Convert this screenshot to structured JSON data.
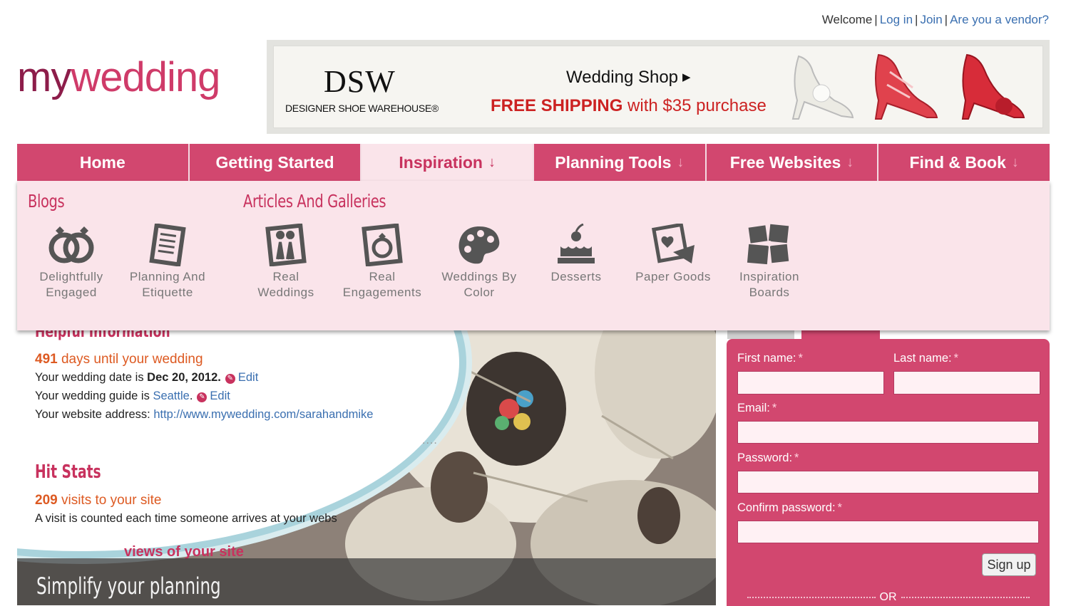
{
  "header": {
    "welcome": "Welcome",
    "login": "Log in",
    "join": "Join",
    "vendor": "Are you a vendor?"
  },
  "logo": {
    "my": "my",
    "wedding": "wedding"
  },
  "banner": {
    "brand": "DSW",
    "brand_sub": "DESIGNER SHOE WAREHOUSE®",
    "shop": "Wedding Shop",
    "free_bold": "FREE SHIPPING",
    "free_rest": " with $35 purchase"
  },
  "nav": {
    "tabs": [
      {
        "label": "Home",
        "arrow": ""
      },
      {
        "label": "Getting Started",
        "arrow": ""
      },
      {
        "label": "Inspiration",
        "arrow": "↓"
      },
      {
        "label": "Planning Tools",
        "arrow": "↓"
      },
      {
        "label": "Free Websites",
        "arrow": "↓"
      },
      {
        "label": "Find & Book",
        "arrow": "↓"
      }
    ]
  },
  "dropdown": {
    "blogs_title": "Blogs",
    "articles_title": "Articles And Galleries",
    "items": [
      {
        "line1": "Delightfully",
        "line2": "Engaged",
        "icon": "rings-icon"
      },
      {
        "line1": "Planning And",
        "line2": "Etiquette",
        "icon": "checklist-icon"
      },
      {
        "line1": "Real",
        "line2": "Weddings",
        "icon": "couple-photo-icon"
      },
      {
        "line1": "Real",
        "line2": "Engagements",
        "icon": "ring-photo-icon"
      },
      {
        "line1": "Weddings By",
        "line2": "Color",
        "icon": "palette-icon"
      },
      {
        "line1": "Desserts",
        "line2": "",
        "icon": "cake-icon"
      },
      {
        "line1": "Paper Goods",
        "line2": "",
        "icon": "envelope-icon"
      },
      {
        "line1": "Inspiration",
        "line2": "Boards",
        "icon": "boards-icon"
      }
    ]
  },
  "info": {
    "heading": "Helpful Information",
    "days_count": "491",
    "days_text": " days until your wedding",
    "date_prefix": "Your wedding date is ",
    "date_value": "Dec 20, 2012.",
    "edit": "Edit",
    "guide_prefix": "Your wedding guide is ",
    "guide_value": "Seattle",
    "guide_suffix": ".",
    "site_prefix": "Your website address: ",
    "site_url": "http://www.mywedding.com/sarahandmike",
    "hit_title": "Hit Stats",
    "visits_count": "209",
    "visits_text": " visits to your site",
    "visit_desc": "A visit is counted each time someone arrives at your webs",
    "partial_views": "views of your site",
    "caption": "Simplify your planning"
  },
  "form": {
    "first_name": "First name:",
    "last_name": "Last name:",
    "email": "Email:",
    "password": "Password:",
    "confirm": "Confirm password:",
    "required": "*",
    "signup": "Sign up",
    "or": "OR"
  }
}
